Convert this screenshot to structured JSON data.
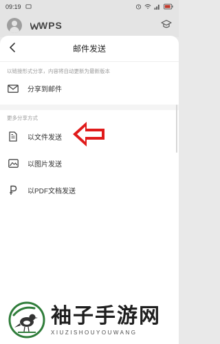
{
  "status_bar": {
    "time": "09:19",
    "icons": [
      "alarm-icon",
      "wifi-icon",
      "signal-icon",
      "battery-icon"
    ]
  },
  "app_header": {
    "brand": "WPS",
    "icons": [
      "avatar",
      "graduation-cap-icon"
    ]
  },
  "sheet": {
    "title": "邮件发送",
    "note": "以链接形式分享，内容将自动更新为最新版本",
    "primary": {
      "label": "分享到邮件",
      "icon": "mail-icon"
    },
    "section_title": "更多分享方式",
    "items": [
      {
        "label": "以文件发送",
        "icon": "document-icon"
      },
      {
        "label": "以图片发送",
        "icon": "image-icon"
      },
      {
        "label": "以PDF文档发送",
        "icon": "pdf-icon"
      }
    ]
  },
  "annotation": {
    "arrow_color": "#e01b1b",
    "points_to": "以文件发送"
  },
  "watermark": {
    "cn": "袖子手游网",
    "en": "XIUZISHOUYOUWANG"
  },
  "colors": {
    "accent_red": "#e01b1b",
    "text": "#333333",
    "muted": "#9a9a9a"
  }
}
